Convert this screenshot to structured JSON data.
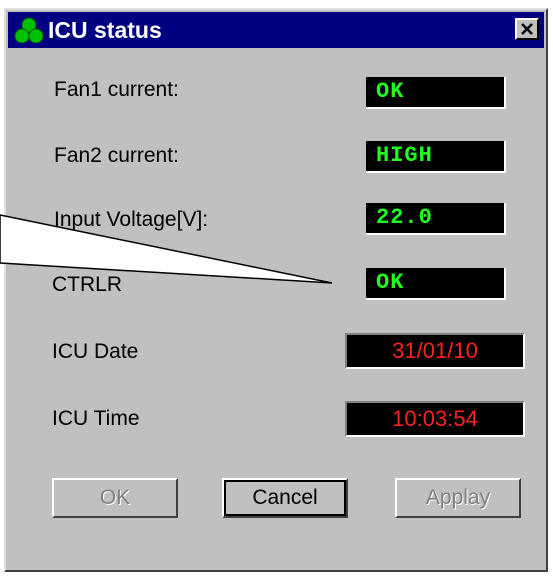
{
  "window": {
    "title": "ICU status",
    "close_symbol": "✕"
  },
  "fields": [
    {
      "label": "Fan1 current:",
      "value": "OK"
    },
    {
      "label": "Fan2 current:",
      "value": "HIGH"
    },
    {
      "label": "Input Voltage[V]:",
      "value": "22.0"
    },
    {
      "label": "CTRLR",
      "value": "OK"
    },
    {
      "label": "ICU Date",
      "value": "31/01/10"
    },
    {
      "label": "ICU Time",
      "value": "10:03:54"
    }
  ],
  "buttons": {
    "ok": "OK",
    "cancel": "Cancel",
    "apply": "Applay"
  },
  "colors": {
    "title_bar": "#000080",
    "status_green": "#20ff20",
    "status_red": "#ff2020",
    "window_bg": "#c0c0c0"
  },
  "icons": {
    "app": "three-green-circles-icon",
    "close": "close-icon"
  }
}
